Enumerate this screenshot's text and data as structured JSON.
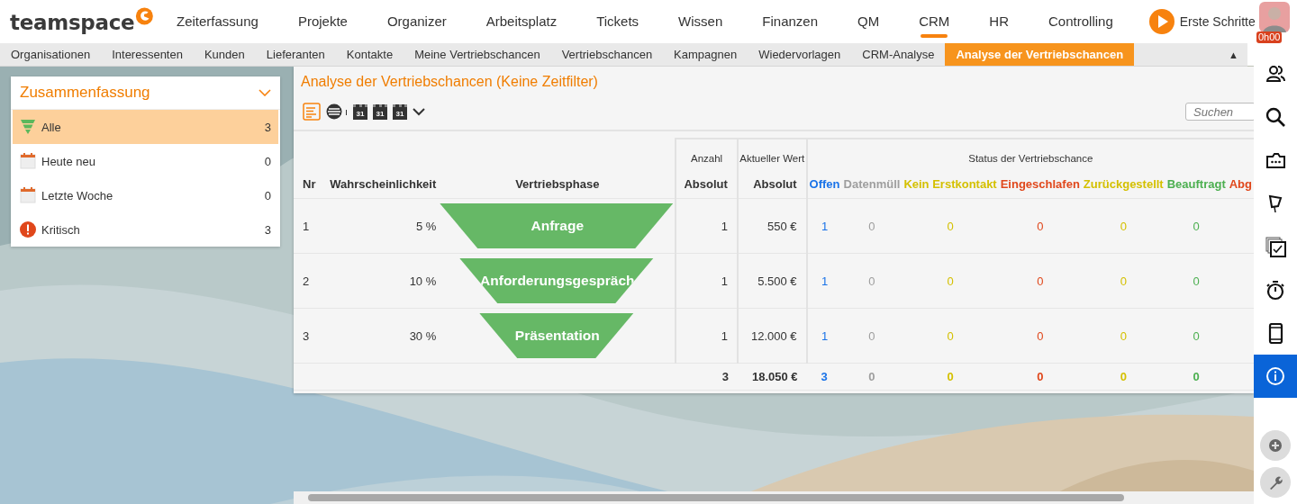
{
  "top_nav": {
    "logo": "teamspace",
    "items": [
      {
        "label": "Zeiterfassung",
        "selected": false
      },
      {
        "label": "Projekte",
        "selected": false
      },
      {
        "label": "Organizer",
        "selected": false
      },
      {
        "label": "Arbeitsplatz",
        "selected": false
      },
      {
        "label": "Tickets",
        "selected": false
      },
      {
        "label": "Wissen",
        "selected": false
      },
      {
        "label": "Finanzen",
        "selected": false
      },
      {
        "label": "QM",
        "selected": false
      },
      {
        "label": "CRM",
        "selected": true
      },
      {
        "label": "HR",
        "selected": false
      },
      {
        "label": "Controlling",
        "selected": false
      }
    ],
    "cta": "Erste Schritte",
    "timer_badge": "0h00"
  },
  "sub_nav": {
    "items": [
      {
        "label": "Organisationen",
        "selected": false
      },
      {
        "label": "Interessenten",
        "selected": false
      },
      {
        "label": "Kunden",
        "selected": false
      },
      {
        "label": "Lieferanten",
        "selected": false
      },
      {
        "label": "Kontakte",
        "selected": false
      },
      {
        "label": "Meine Vertriebschancen",
        "selected": false
      },
      {
        "label": "Vertriebschancen",
        "selected": false
      },
      {
        "label": "Kampagnen",
        "selected": false
      },
      {
        "label": "Wiedervorlagen",
        "selected": false
      },
      {
        "label": "CRM-Analyse",
        "selected": false
      },
      {
        "label": "Analyse der Vertriebschancen",
        "selected": true
      }
    ],
    "collapse": "▲"
  },
  "summary": {
    "title": "Zusammenfassung",
    "items": [
      {
        "kind": "funnel",
        "label": "Alle",
        "count": "3",
        "selected": true
      },
      {
        "kind": "calendar",
        "label": "Heute neu",
        "count": "0",
        "selected": false
      },
      {
        "kind": "calendar",
        "label": "Letzte Woche",
        "count": "0",
        "selected": false
      },
      {
        "kind": "alert",
        "label": "Kritisch",
        "count": "3",
        "selected": false
      }
    ]
  },
  "analysis": {
    "title": "Analyse der Vertriebschancen (Keine Zeitfilter)",
    "toolbar": [
      {
        "kind": "list",
        "selected": true
      },
      {
        "kind": "stack",
        "selected": false
      },
      {
        "kind": "calendar",
        "label": "31",
        "selected": false
      },
      {
        "kind": "calendar",
        "label": "31",
        "selected": false
      },
      {
        "kind": "calendar",
        "label": "31",
        "selected": false
      },
      {
        "kind": "caret",
        "selected": false
      }
    ],
    "search": {
      "placeholder": "Suchen"
    },
    "table": {
      "groups": [
        "Anzahl",
        "Aktueller Wert",
        "Status der Vertriebschance"
      ],
      "columns": [
        "Nr",
        "Wahrscheinlichkeit",
        "Vertriebsphase",
        "Absolut",
        "Absolut"
      ],
      "statuses": [
        {
          "label": "Offen",
          "color": "#1a73e8"
        },
        {
          "label": "Datenmüll",
          "color": "#9e9e9e"
        },
        {
          "label": "Kein Erstkontakt",
          "color": "#d4c000"
        },
        {
          "label": "Eingeschlafen",
          "color": "#e0471b"
        },
        {
          "label": "Zurückgestellt",
          "color": "#d4c000"
        },
        {
          "label": "Beauftragt",
          "color": "#4caf50"
        },
        {
          "label": "Abg",
          "color": "#e0471b"
        }
      ],
      "rows": [
        {
          "nr": "1",
          "probability": "5 %",
          "phase": "Anfrage",
          "count": "1",
          "value": "550 €",
          "status_values": [
            "1",
            "0",
            "0",
            "0",
            "0",
            "0"
          ]
        },
        {
          "nr": "2",
          "probability": "10 %",
          "phase": "Anforderungsgespräch",
          "count": "1",
          "value": "5.500 €",
          "status_values": [
            "1",
            "0",
            "0",
            "0",
            "0",
            "0"
          ]
        },
        {
          "nr": "3",
          "probability": "30 %",
          "phase": "Präsentation",
          "count": "1",
          "value": "12.000 €",
          "status_values": [
            "1",
            "0",
            "0",
            "0",
            "0",
            "0"
          ]
        }
      ],
      "totals": {
        "count": "3",
        "value": "18.050 €",
        "status_values": [
          "3",
          "0",
          "0",
          "0",
          "0",
          "0"
        ]
      }
    }
  },
  "side_tools": [
    {
      "kind": "people",
      "selected": false
    },
    {
      "kind": "search",
      "selected": false
    },
    {
      "kind": "folder",
      "selected": false
    },
    {
      "kind": "pin",
      "selected": false
    },
    {
      "kind": "tasks",
      "selected": false
    },
    {
      "kind": "stopwatch",
      "selected": false
    },
    {
      "kind": "phone",
      "selected": false
    },
    {
      "kind": "info",
      "selected": true
    }
  ],
  "side_actions": [
    {
      "kind": "add"
    },
    {
      "kind": "wrench"
    }
  ]
}
